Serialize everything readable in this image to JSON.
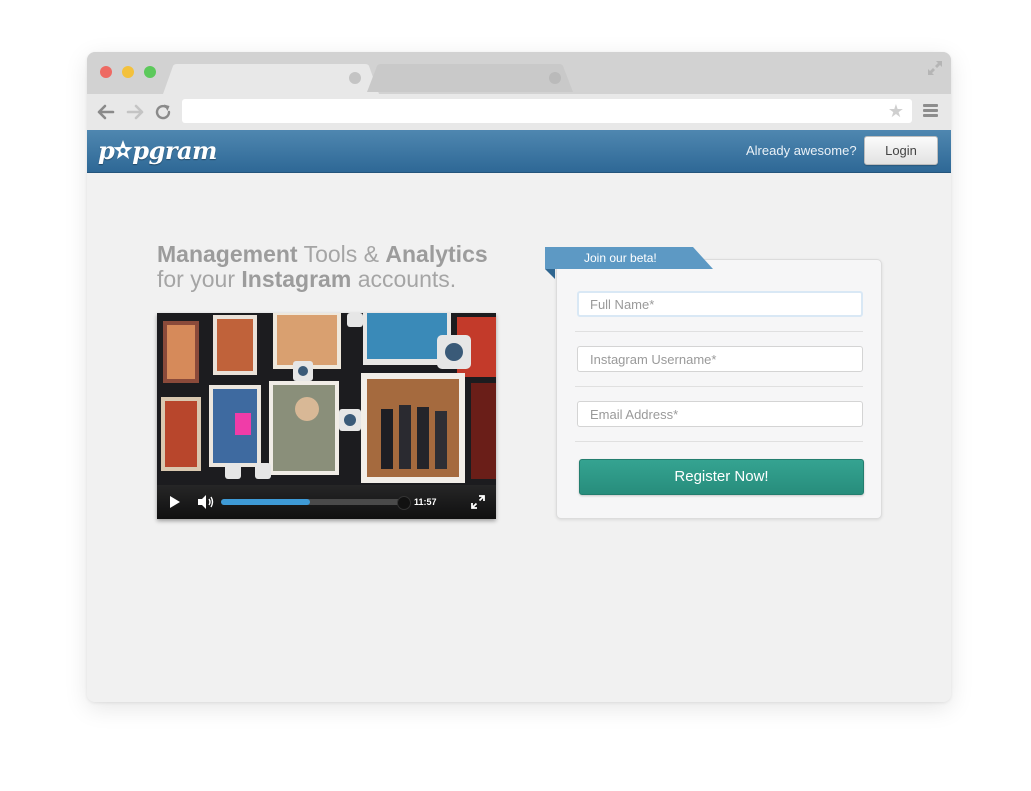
{
  "browser": {
    "tabs": [
      {
        "label": ""
      },
      {
        "label": ""
      }
    ],
    "url": ""
  },
  "header": {
    "logo_text_before": "p",
    "logo_text_after": "pgram",
    "tagline": "Already awesome?",
    "login_label": "Login",
    "background_color": "#3b77a3"
  },
  "hero": {
    "line1": {
      "bold1": "Management",
      "text1": " Tools & ",
      "bold2": "Analytics"
    },
    "line2": {
      "text1": "for your ",
      "bold1": "Instagram",
      "text2": " accounts."
    }
  },
  "video": {
    "time": "11:57",
    "progress": 0.48
  },
  "signup": {
    "ribbon": "Join our beta!",
    "fields": [
      {
        "placeholder": "Full Name*",
        "value": ""
      },
      {
        "placeholder": "Instagram Username*",
        "value": ""
      },
      {
        "placeholder": "Email Address*",
        "value": ""
      }
    ],
    "submit_label": "Register Now!",
    "accent_color": "#2e9a88"
  }
}
